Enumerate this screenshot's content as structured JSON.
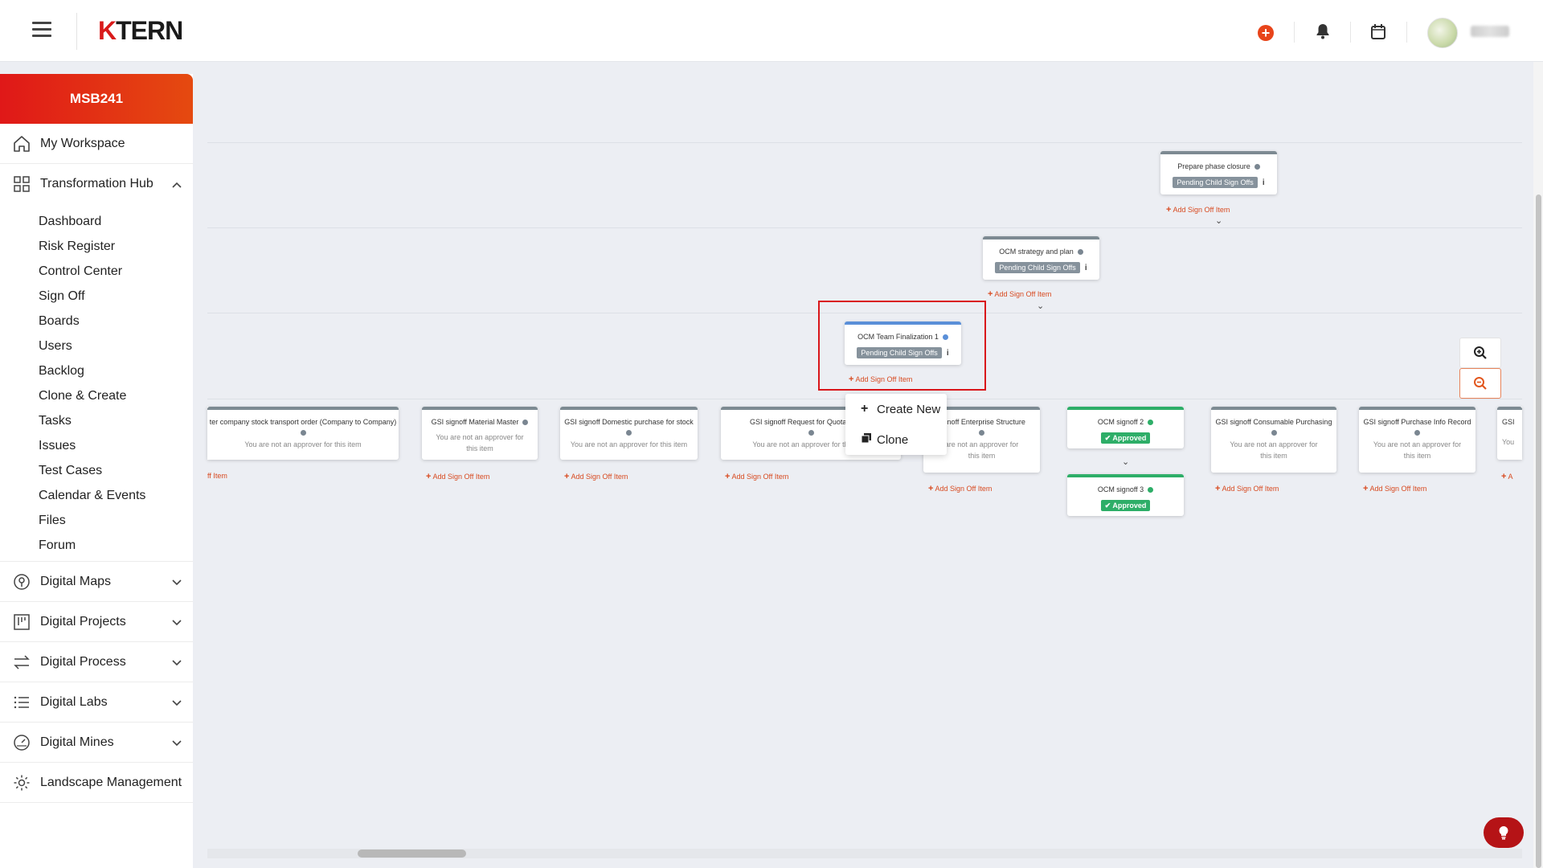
{
  "header": {
    "logo_k": "K",
    "logo_rest": "TERN",
    "icons": [
      "menu-icon",
      "add-circle-icon",
      "bell-icon",
      "calendar-icon",
      "user-avatar"
    ]
  },
  "sidebar": {
    "project": "MSB241",
    "my_workspace": "My Workspace",
    "transformation_hub": "Transformation Hub",
    "hub_items": [
      "Dashboard",
      "Risk Register",
      "Control Center",
      "Sign Off",
      "Boards",
      "Users",
      "Backlog",
      "Clone & Create",
      "Tasks",
      "Issues",
      "Test Cases",
      "Calendar & Events",
      "Files",
      "Forum"
    ],
    "sections": [
      "Digital Maps",
      "Digital Projects",
      "Digital Process",
      "Digital Labs",
      "Digital Mines"
    ],
    "landscape": "Landscape Management"
  },
  "tree": {
    "prepare": {
      "title": "Prepare phase closure",
      "status": "Pending Child Sign Offs"
    },
    "ocm_strategy": {
      "title": "OCM strategy and plan",
      "status": "Pending Child Sign Offs"
    },
    "ocm_team": {
      "title": "OCM Team Finalization 1",
      "status": "Pending Child Sign Offs"
    },
    "info": "i",
    "add_item": "Add Sign Off Item",
    "add_item_partial": "ff Item",
    "not_approver": "You are not an approver for this item",
    "not_approver_line1": "You are not an approver for",
    "not_approver_line2": "this item",
    "not_approver_cut1": "are not an approver for",
    "not_approver_partial": "You",
    "approved": "Approved",
    "children": {
      "c1": "ter company stock transport order (Company to Company)",
      "c2": "GSI signoff Material Master",
      "c3": "GSI signoff Domestic purchase for stock",
      "c4": "GSI signoff Request for Quotation & V",
      "c5": " signoff Enterprise Structure",
      "c6": "OCM signoff 2",
      "c6b": "OCM signoff 3",
      "c7": "GSI signoff Consumable Purchasing",
      "c8": "GSI signoff Purchase Info Record",
      "c9": "GSI"
    }
  },
  "context_menu": {
    "create_new": "Create New",
    "clone": "Clone"
  },
  "colors": {
    "brand_red": "#e01818",
    "accent_orange": "#e8441a",
    "approved_green": "#2eae68",
    "pending_gray": "#86929c"
  }
}
